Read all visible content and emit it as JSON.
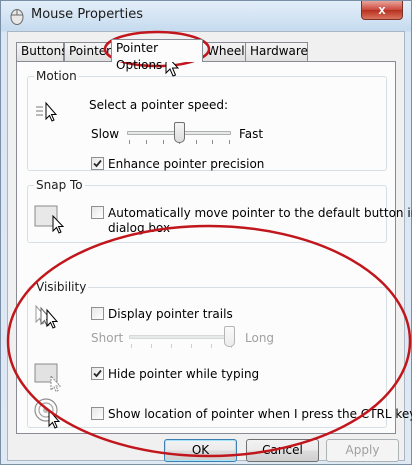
{
  "window": {
    "title": "Mouse Properties",
    "close_label": "x"
  },
  "tabs": [
    {
      "label": "Buttons",
      "active": false
    },
    {
      "label": "Pointers",
      "active": false
    },
    {
      "label": "Pointer Options",
      "active": true
    },
    {
      "label": "Wheel",
      "active": false
    },
    {
      "label": "Hardware",
      "active": false
    }
  ],
  "motion": {
    "group_title": "Motion",
    "speed_label": "Select a pointer speed:",
    "slow_label": "Slow",
    "fast_label": "Fast",
    "speed_level": 0.5,
    "enhance_label": "Enhance pointer precision",
    "enhance_checked": true
  },
  "snap_to": {
    "group_title": "Snap To",
    "auto_label_line1": "Automatically move pointer to the default button in a",
    "auto_label_line2": "dialog box",
    "auto_checked": false
  },
  "visibility": {
    "group_title": "Visibility",
    "trails_label": "Display pointer trails",
    "trails_checked": false,
    "short_label": "Short",
    "long_label": "Long",
    "trail_level": 1.0,
    "hide_label": "Hide pointer while typing",
    "hide_checked": true,
    "ctrl_label": "Show location of pointer when I press the CTRL key",
    "ctrl_checked": false
  },
  "buttons": {
    "ok": "OK",
    "cancel": "Cancel",
    "apply": "Apply"
  },
  "annotation_color": "#c0161c"
}
